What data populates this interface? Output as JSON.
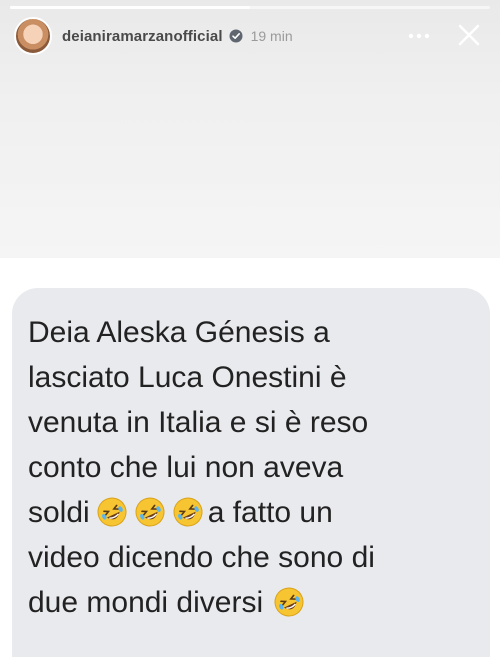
{
  "story": {
    "progress": 0.5,
    "username": "deianiramarzanofficial",
    "time": "19 min",
    "more_icon": "more-horizontal-icon",
    "close_icon": "close-icon",
    "verified_icon": "verified-badge-icon"
  },
  "message": {
    "lines": [
      "Deia Aleska Génesis a",
      "lasciato Luca Onestini è",
      "venuta in Italia e si è reso",
      "conto che lui non aveva",
      "soldi",
      "a fatto un",
      "video dicendo che sono di",
      "due mondi diversi"
    ],
    "emoji": "rolling-on-floor-laughing-emoji",
    "colors": {
      "card_background": "#e9eaee",
      "text": "#222222"
    }
  }
}
